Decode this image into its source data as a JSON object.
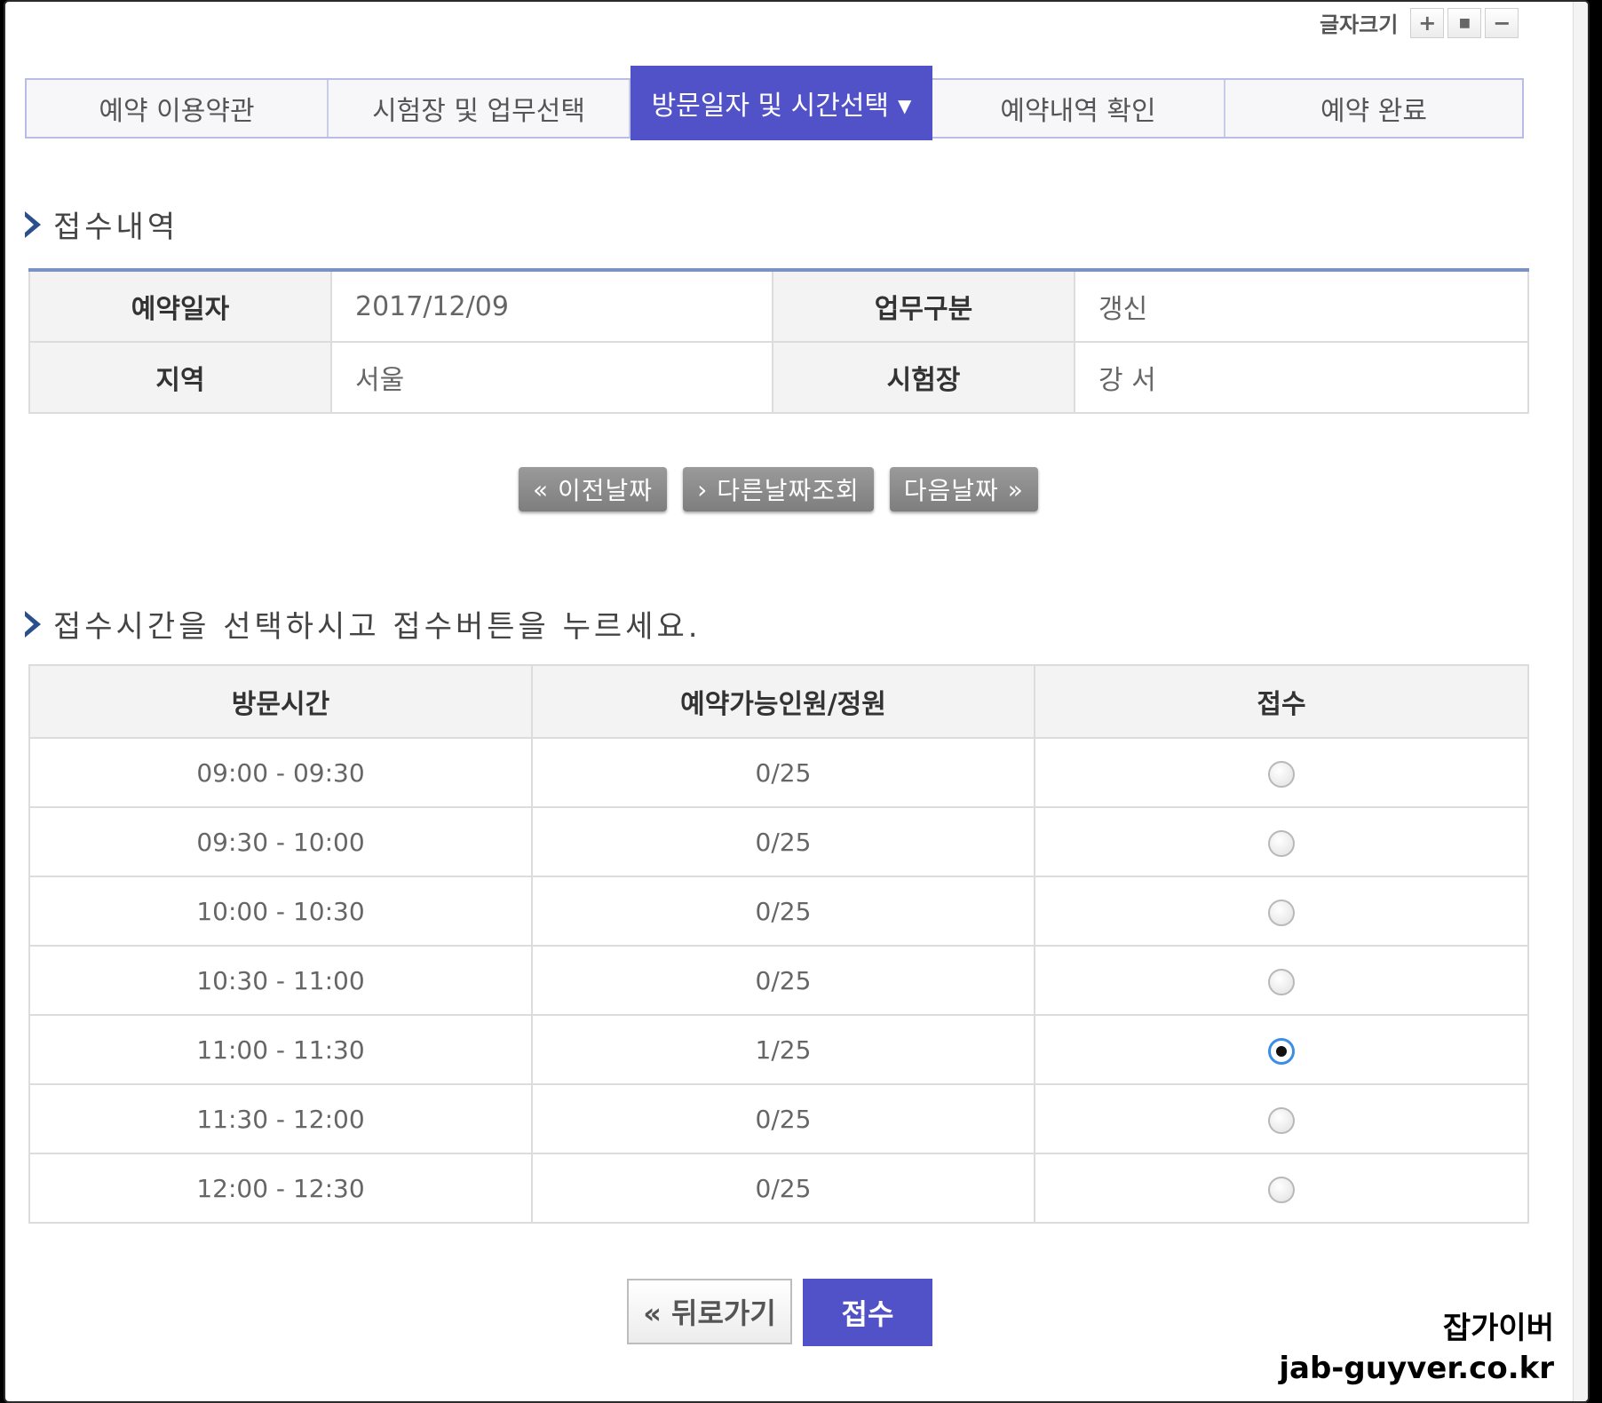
{
  "font_size_control": {
    "label": "글자크기",
    "plus": "+",
    "reset": "■",
    "minus": "−"
  },
  "steps": [
    {
      "label": "예약 이용약관"
    },
    {
      "label": "시험장 및 업무선택"
    },
    {
      "label": "방문일자 및 시간선택",
      "active": true
    },
    {
      "label": "예약내역 확인"
    },
    {
      "label": "예약 완료"
    }
  ],
  "receipt": {
    "title": "접수내역",
    "rows": [
      {
        "h1": "예약일자",
        "v1": "2017/12/09",
        "h2": "업무구분",
        "v2": "갱신"
      },
      {
        "h1": "지역",
        "v1": "서울",
        "h2": "시험장",
        "v2": "강 서"
      }
    ]
  },
  "nav": {
    "prev": "이전날짜",
    "other": "다른날짜조회",
    "next": "다음날짜"
  },
  "instruction": "접수시간을 선택하시고 접수버튼을 누르세요.",
  "time_table": {
    "headers": {
      "time": "방문시간",
      "capacity": "예약가능인원/정원",
      "select": "접수"
    },
    "rows": [
      {
        "time": "09:00 - 09:30",
        "capacity": "0/25",
        "selected": false
      },
      {
        "time": "09:30 - 10:00",
        "capacity": "0/25",
        "selected": false
      },
      {
        "time": "10:00 - 10:30",
        "capacity": "0/25",
        "selected": false
      },
      {
        "time": "10:30 - 11:00",
        "capacity": "0/25",
        "selected": false
      },
      {
        "time": "11:00 - 11:30",
        "capacity": "1/25",
        "selected": true
      },
      {
        "time": "11:30 - 12:00",
        "capacity": "0/25",
        "selected": false
      },
      {
        "time": "12:00 - 12:30",
        "capacity": "0/25",
        "selected": false
      }
    ]
  },
  "buttons": {
    "back": "« 뒤로가기",
    "submit": "접수"
  },
  "watermark": {
    "line1": "잡가이버",
    "line2": "jab-guyver.co.kr"
  },
  "colors": {
    "accent": "#5252c8",
    "table_top": "#7b93c4",
    "bullet": "#2b4e8c"
  }
}
